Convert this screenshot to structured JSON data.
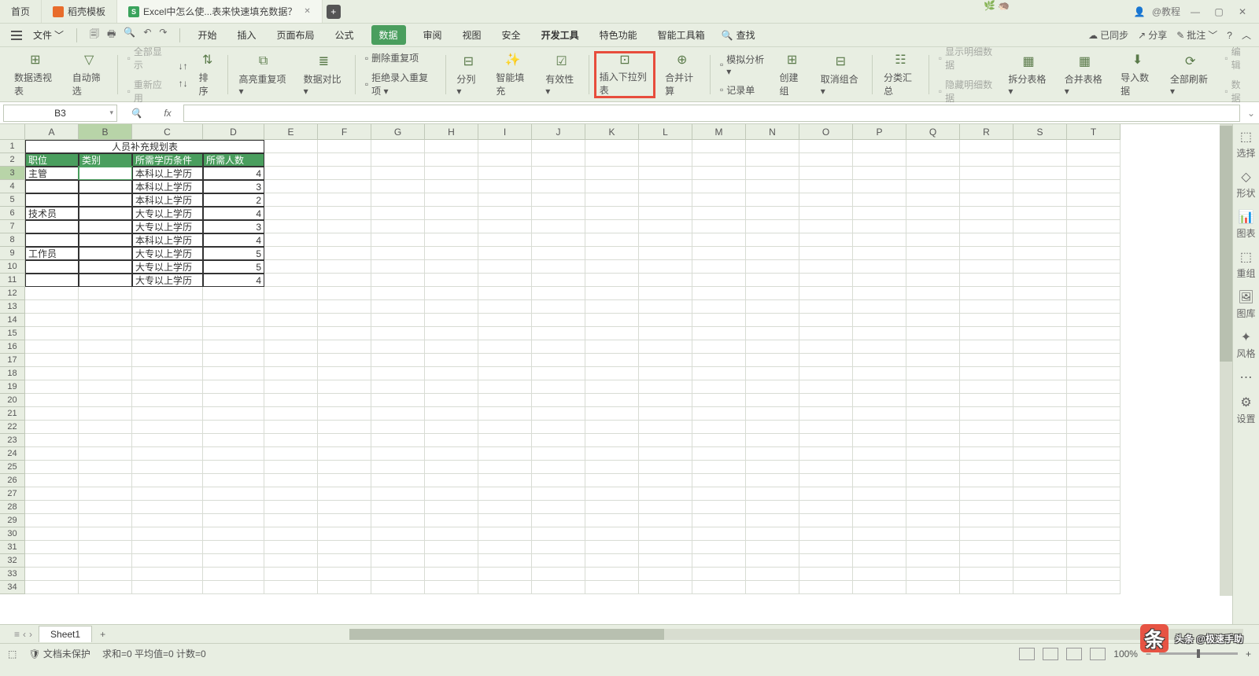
{
  "titlebar": {
    "tabs": [
      {
        "label": "首页"
      },
      {
        "label": "稻壳模板"
      },
      {
        "label": "Excel中怎么使...表来快速填充数据？"
      }
    ],
    "user": "@教程"
  },
  "menubar": {
    "file": "文件",
    "tabs": [
      "开始",
      "插入",
      "页面布局",
      "公式",
      "数据",
      "审阅",
      "视图",
      "安全",
      "开发工具",
      "特色功能",
      "智能工具箱"
    ],
    "active": "数据",
    "search": "查找",
    "sync": "已同步",
    "share": "分享",
    "annotate": "批注"
  },
  "ribbon": {
    "items": [
      {
        "label": "数据透视表"
      },
      {
        "label": "自动筛选"
      },
      {
        "group": [
          {
            "label": "全部显示",
            "dis": true
          },
          {
            "label": "重新应用",
            "dis": true
          }
        ]
      },
      {
        "group2": [
          {
            "label": "↓↑"
          },
          {
            "label": "↑↓"
          }
        ],
        "label2": "排序"
      },
      {
        "label": "高亮重复项",
        "dd": true
      },
      {
        "label": "数据对比",
        "dd": true
      },
      {
        "group": [
          {
            "label": "删除重复项"
          },
          {
            "label": "拒绝录入重复项",
            "dd": true
          }
        ]
      },
      {
        "label": "分列",
        "dd": true
      },
      {
        "label": "智能填充"
      },
      {
        "label": "有效性",
        "dd": true
      },
      {
        "label": "插入下拉列表",
        "hl": true
      },
      {
        "label": "合并计算"
      },
      {
        "group": [
          {
            "label": "模拟分析",
            "dd": true
          },
          {
            "label": "记录单"
          }
        ]
      },
      {
        "label": "创建组"
      },
      {
        "label": "取消组合",
        "dd": true
      },
      {
        "label": "分类汇总"
      },
      {
        "group": [
          {
            "label": "显示明细数据",
            "dis": true
          },
          {
            "label": "隐藏明细数据",
            "dis": true
          }
        ]
      },
      {
        "label": "拆分表格",
        "dd": true
      },
      {
        "label": "合并表格",
        "dd": true
      },
      {
        "label": "导入数据"
      },
      {
        "label": "全部刷新",
        "dd": true
      },
      {
        "group": [
          {
            "label": "编辑",
            "dis": true
          },
          {
            "label": "数据",
            "dis": true
          }
        ]
      }
    ]
  },
  "namebox": "B3",
  "fx": "fx",
  "columns": [
    "A",
    "B",
    "C",
    "D",
    "E",
    "F",
    "G",
    "H",
    "I",
    "J",
    "K",
    "L",
    "M",
    "N",
    "O",
    "P",
    "Q",
    "R",
    "S",
    "T"
  ],
  "table": {
    "title": "人员补充规划表",
    "headers": [
      "职位",
      "类别",
      "所需学历条件",
      "所需人数"
    ],
    "rows": [
      {
        "pos": "主管",
        "edu": "本科以上学历",
        "n": "4"
      },
      {
        "pos": "",
        "edu": "本科以上学历",
        "n": "3"
      },
      {
        "pos": "",
        "edu": "本科以上学历",
        "n": "2"
      },
      {
        "pos": "技术员",
        "edu": "大专以上学历",
        "n": "4"
      },
      {
        "pos": "",
        "edu": "大专以上学历",
        "n": "3"
      },
      {
        "pos": "",
        "edu": "本科以上学历",
        "n": "4"
      },
      {
        "pos": "工作员",
        "edu": "大专以上学历",
        "n": "5"
      },
      {
        "pos": "",
        "edu": "大专以上学历",
        "n": "5"
      },
      {
        "pos": "",
        "edu": "大专以上学历",
        "n": "4"
      }
    ]
  },
  "sheettab": "Sheet1",
  "statusbar": {
    "protect": "文档未保护",
    "sum": "求和=0  平均值=0  计数=0",
    "zoom": "100%"
  },
  "sidepanel": [
    "选择",
    "形状",
    "图表",
    "重组",
    "图库",
    "风格",
    "",
    "设置"
  ],
  "watermark": "头条 @极速手助"
}
